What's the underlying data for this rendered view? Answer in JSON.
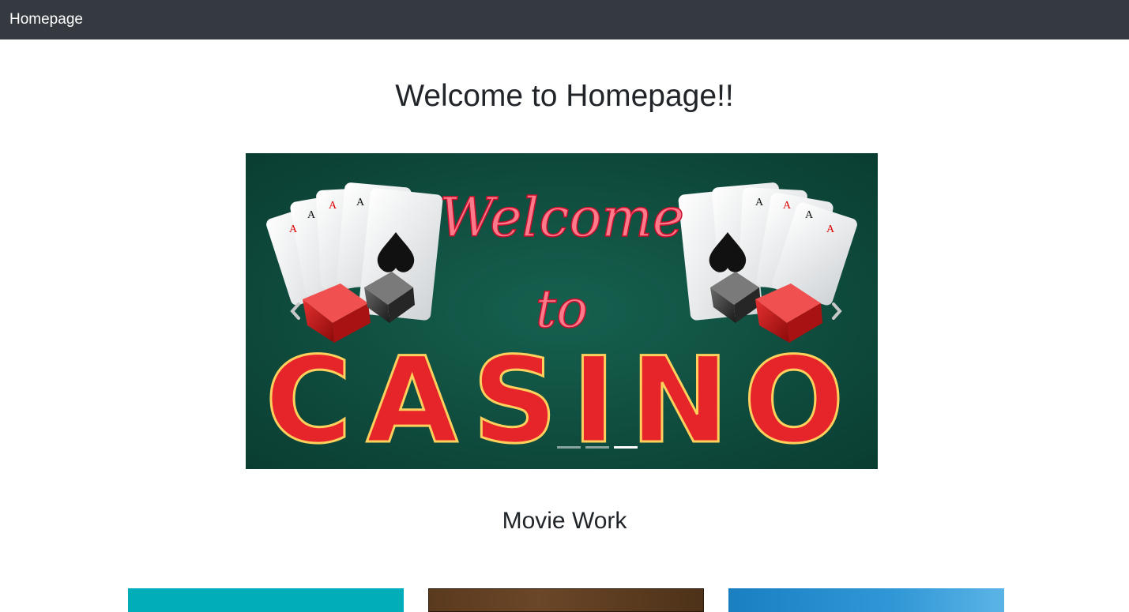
{
  "navbar": {
    "brand": "Homepage"
  },
  "page": {
    "title": "Welcome to Homepage!!"
  },
  "carousel": {
    "slide_text_line1": "Welcome",
    "slide_text_line2": "to",
    "slide_text_line3": "CASINO",
    "slide_count": 3,
    "active_slide": 3,
    "prev_icon": "chevron-left-icon",
    "next_icon": "chevron-right-icon"
  },
  "section": {
    "title": "Movie Work"
  },
  "colors": {
    "navbar_bg": "#343a40",
    "felt_green": "#0d4b3e",
    "card1": "#00adb9",
    "card2": "#5a3a1e",
    "card3": "#1a7fc1"
  }
}
